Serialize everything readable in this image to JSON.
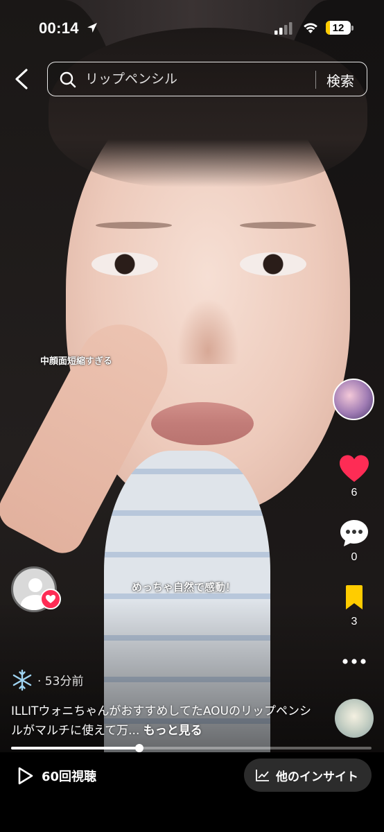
{
  "status_bar": {
    "time": "00:14",
    "battery": "12"
  },
  "search": {
    "placeholder": "リップペンシル",
    "button_label": "検索"
  },
  "captions": {
    "upper": "中顔面短縮すぎる",
    "middle": "めっちゃ自然で感動！"
  },
  "actions": {
    "likes": "6",
    "comments": "0",
    "saves": "3"
  },
  "post": {
    "time_ago": "· 53分前",
    "description": "ILLITウォニちゃんがおすすめしてたAOUのリップペンシルがマルチに使えて万... ",
    "more_label": "もっと見る"
  },
  "playback": {
    "progress": 0.355
  },
  "bottom_bar": {
    "views": "60回視聴",
    "insight_label": "他のインサイト"
  },
  "colors": {
    "like": "#fe2c55",
    "bookmark": "#ffcc00"
  }
}
